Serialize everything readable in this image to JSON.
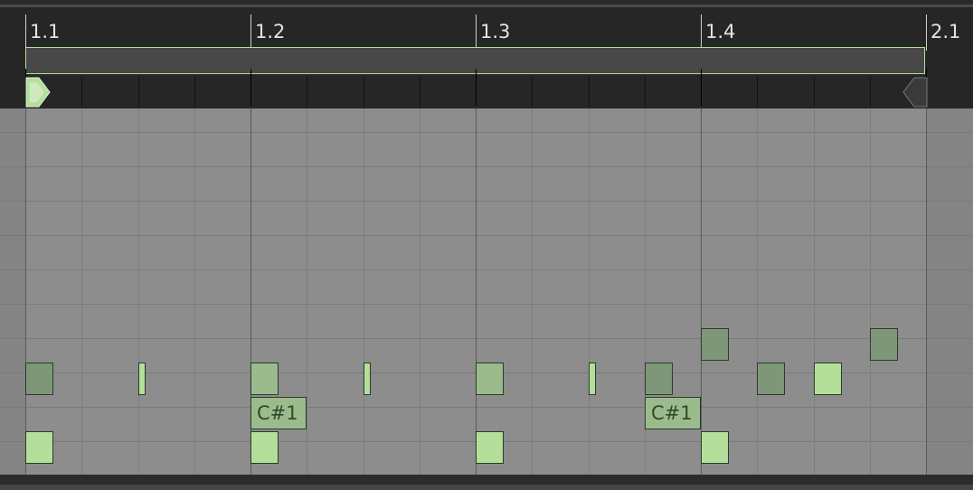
{
  "ruler": {
    "bars": [
      "1.1",
      "1.2",
      "1.3",
      "1.4",
      "2.1"
    ]
  },
  "colors": {
    "accent": "#b4e09a",
    "note_bright": "#b3df9b",
    "note_mid": "#9cbb8d",
    "note_dim": "#7f9779",
    "grid": "#8d8d8d"
  },
  "notes": [
    {
      "row": 7,
      "beat": 0,
      "length": 0.5,
      "shade": "dim",
      "label": ""
    },
    {
      "row": 9,
      "beat": 0,
      "length": 0.5,
      "shade": "bright",
      "label": ""
    },
    {
      "row": 7,
      "beat": 2,
      "length": 0.12,
      "shade": "bright",
      "label": ""
    },
    {
      "row": 7,
      "beat": 4,
      "length": 0.5,
      "shade": "mid",
      "label": ""
    },
    {
      "row": 8,
      "beat": 4,
      "length": 1,
      "shade": "mid",
      "label": "C#1"
    },
    {
      "row": 9,
      "beat": 4,
      "length": 0.5,
      "shade": "bright",
      "label": ""
    },
    {
      "row": 7,
      "beat": 6,
      "length": 0.12,
      "shade": "bright",
      "label": ""
    },
    {
      "row": 7,
      "beat": 8,
      "length": 0.5,
      "shade": "mid",
      "label": ""
    },
    {
      "row": 9,
      "beat": 8,
      "length": 0.5,
      "shade": "bright",
      "label": ""
    },
    {
      "row": 7,
      "beat": 10,
      "length": 0.12,
      "shade": "bright",
      "label": ""
    },
    {
      "row": 7,
      "beat": 11,
      "length": 0.5,
      "shade": "dim",
      "label": ""
    },
    {
      "row": 8,
      "beat": 11,
      "length": 1,
      "shade": "mid",
      "label": "C#1"
    },
    {
      "row": 6,
      "beat": 12,
      "length": 0.5,
      "shade": "dim",
      "label": ""
    },
    {
      "row": 9,
      "beat": 12,
      "length": 0.5,
      "shade": "bright",
      "label": ""
    },
    {
      "row": 7,
      "beat": 13,
      "length": 0.5,
      "shade": "dim",
      "label": ""
    },
    {
      "row": 7,
      "beat": 14,
      "length": 0.5,
      "shade": "bright",
      "label": ""
    },
    {
      "row": 6,
      "beat": 15,
      "length": 0.5,
      "shade": "dim",
      "label": ""
    }
  ]
}
